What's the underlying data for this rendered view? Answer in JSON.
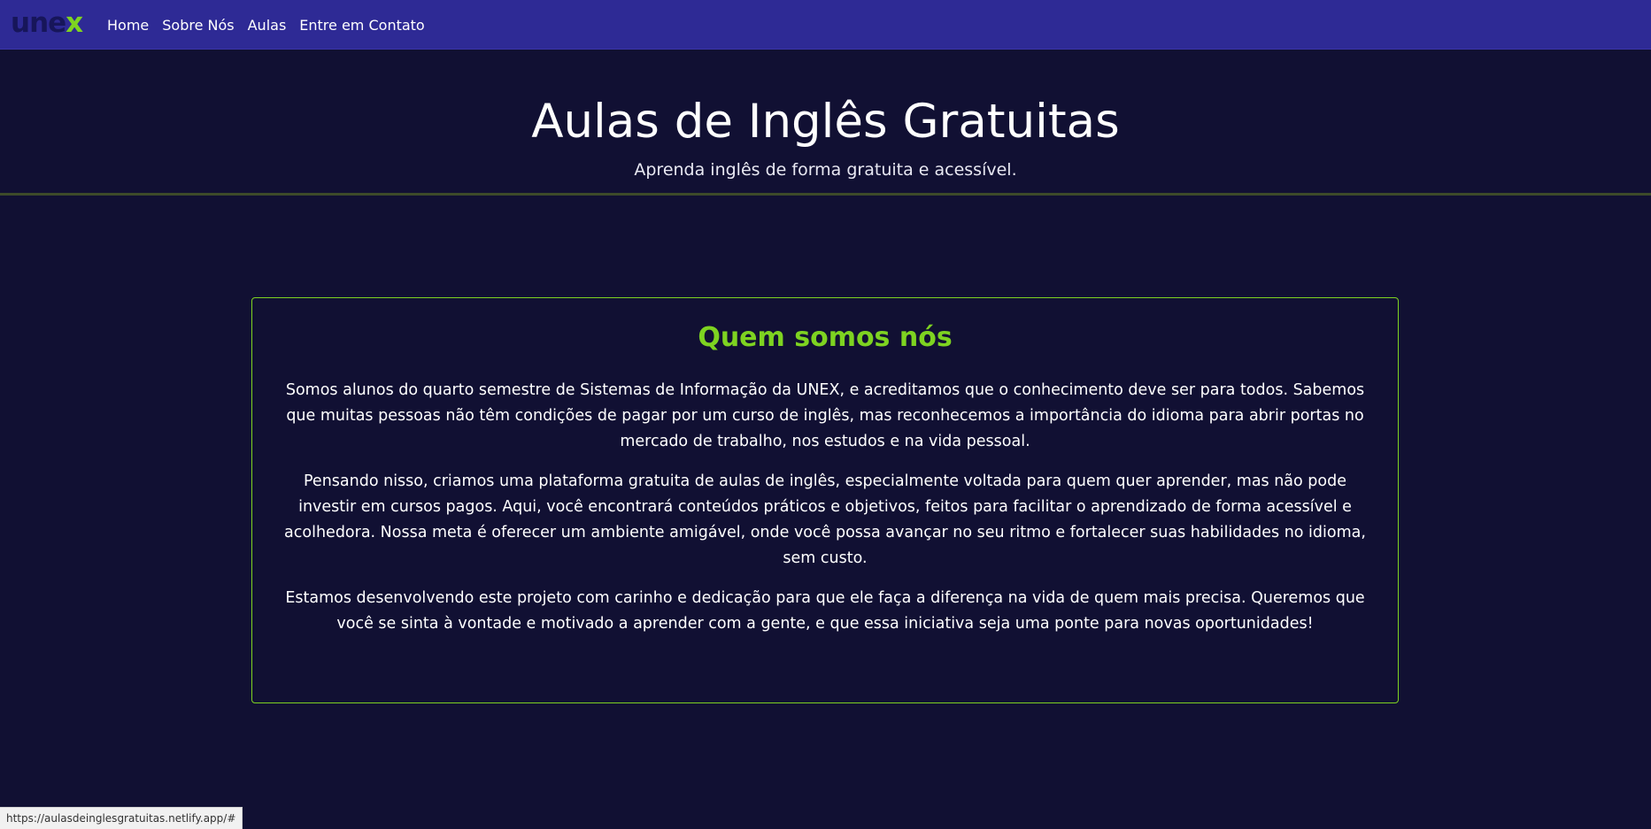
{
  "nav": {
    "logo_text": "une",
    "logo_accent": "x",
    "links": [
      "Home",
      "Sobre Nós",
      "Aulas",
      "Entre em Contato"
    ]
  },
  "hero": {
    "title": "Aulas de Inglês Gratuitas",
    "subtitle": "Aprenda inglês de forma gratuita e acessível."
  },
  "about": {
    "title": "Quem somos nós",
    "paragraphs": [
      "Somos alunos do quarto semestre de Sistemas de Informação da UNEX, e acreditamos que o conhecimento deve ser para todos. Sabemos que muitas pessoas não têm condições de pagar por um curso de inglês, mas reconhecemos a importância do idioma para abrir portas no mercado de trabalho, nos estudos e na vida pessoal.",
      "Pensando nisso, criamos uma plataforma gratuita de aulas de inglês, especialmente voltada para quem quer aprender, mas não pode investir em cursos pagos. Aqui, você encontrará conteúdos práticos e objetivos, feitos para facilitar o aprendizado de forma acessível e acolhedora. Nossa meta é oferecer um ambiente amigável, onde você possa avançar no seu ritmo e fortalecer suas habilidades no idioma, sem custo.",
      "Estamos desenvolvendo este projeto com carinho e dedicação para que ele faça a diferença na vida de quem mais precisa. Queremos que você se sinta à vontade e motivado a aprender com a gente, e que essa iniciativa seja uma ponte para novas oportunidades!"
    ]
  },
  "status_bar": {
    "url": "https://aulasdeinglesgratuitas.netlify.app/#"
  },
  "colors": {
    "background": "#111033",
    "navbar": "#2e2a95",
    "accent_green": "#7ed321"
  }
}
